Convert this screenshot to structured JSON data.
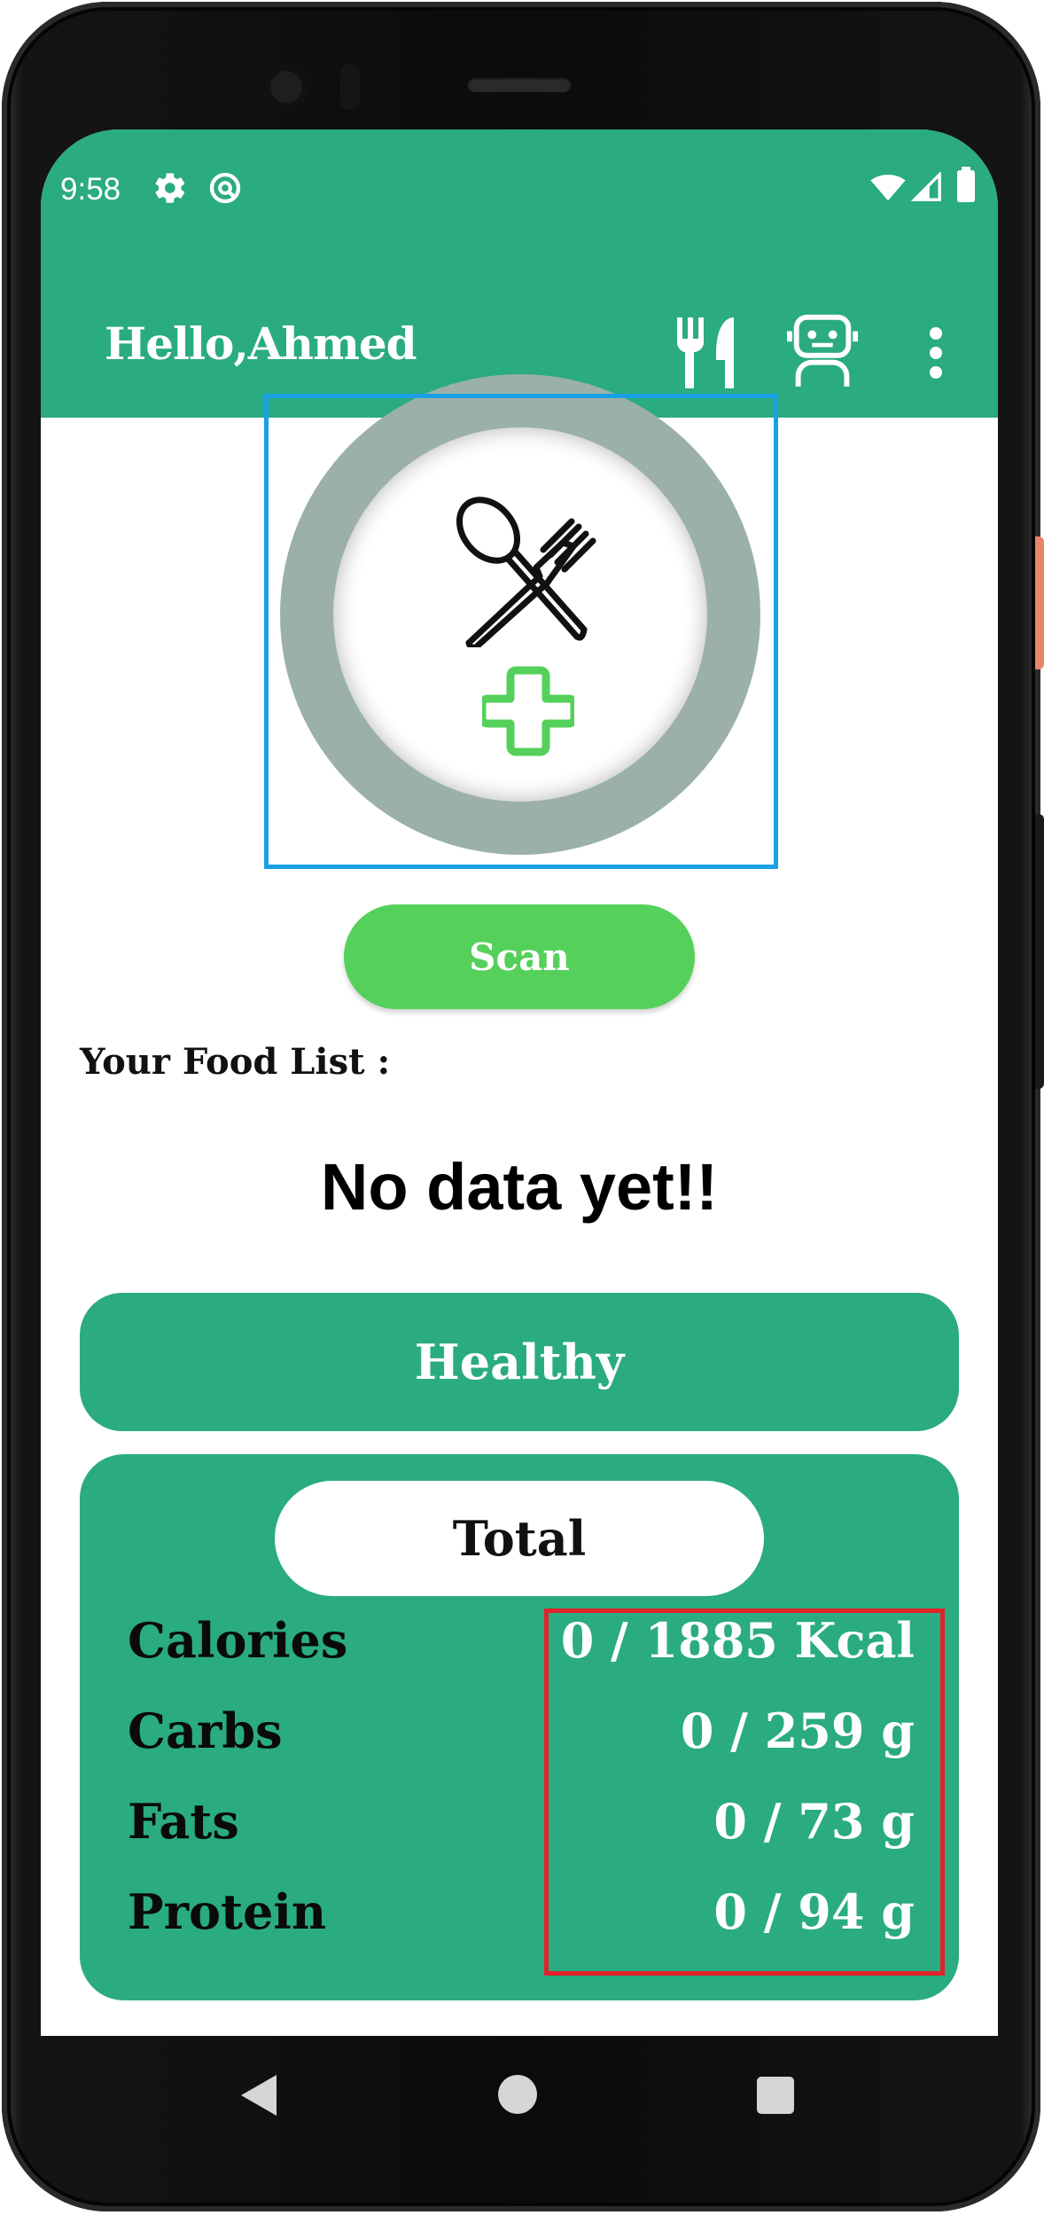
{
  "status_bar": {
    "time": "9:58"
  },
  "app_bar": {
    "title": "Hello,Ahmed",
    "icons": [
      "restaurant-icon",
      "robot-icon",
      "more-vert-icon"
    ]
  },
  "scan": {
    "button_label": "Scan"
  },
  "food_list": {
    "label": "Your Food List :",
    "empty_message": "No data yet!!"
  },
  "healthy": {
    "label": "Healthy"
  },
  "total": {
    "title": "Total",
    "rows": [
      {
        "name": "Calories",
        "value": "0 / 1885 Kcal"
      },
      {
        "name": "Carbs",
        "value": "0 / 259 g"
      },
      {
        "name": "Fats",
        "value": "0 / 73 g"
      },
      {
        "name": "Protein",
        "value": "0 / 94 g"
      }
    ]
  },
  "colors": {
    "primary": "#2aab82",
    "scan_button": "#55d05a",
    "plate_ring": "#9ab0a8",
    "highlight_blue": "#1aa0e6",
    "highlight_red": "#e0232a"
  }
}
